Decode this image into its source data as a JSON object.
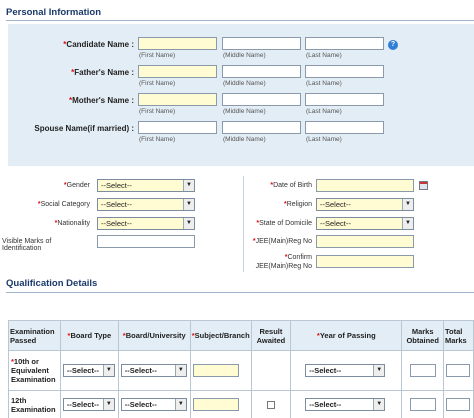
{
  "personal": {
    "title": "Personal Information",
    "rows": [
      {
        "label": "Candidate Name :",
        "required": "*"
      },
      {
        "label": "Father's Name :",
        "required": "*"
      },
      {
        "label": "Mother's Name :",
        "required": "*"
      },
      {
        "label": "Spouse Name(if married) :",
        "required": ""
      }
    ],
    "hints": {
      "first": "(First Name)",
      "middle": "(Middle Name)",
      "last": "(Last Name)"
    },
    "help_glyph": "?"
  },
  "details": {
    "left": [
      {
        "label": "Gender",
        "required": "*",
        "value": "--Select--"
      },
      {
        "label": "Social Category",
        "required": "*",
        "value": "--Select--"
      },
      {
        "label": "Nationality",
        "required": "*",
        "value": "--Select--"
      },
      {
        "label": "Visible Marks of Identification",
        "required": "",
        "value": ""
      }
    ],
    "right": [
      {
        "label": "Date of Birth",
        "required": "*",
        "value": ""
      },
      {
        "label": "Religion",
        "required": "*",
        "value": "--Select--"
      },
      {
        "label": "State of Domicile",
        "required": "*",
        "value": "--Select--"
      },
      {
        "label": "JEE(Main)Reg No",
        "required": "*",
        "value": ""
      },
      {
        "label_line1": "Confirm",
        "label_line2": "JEE(Main)Reg No",
        "required": "*",
        "value": ""
      }
    ]
  },
  "qualification": {
    "title": "Qualification Details",
    "headers": {
      "exam": "Examination Passed",
      "board_type": "Board Type",
      "board_univ": "Board/University",
      "subject": "Subject/Branch",
      "result": "Result Awaited",
      "year": "Year of Passing",
      "marks": "Marks Obtained",
      "total": "Total Marks"
    },
    "rows": [
      {
        "exam": "10th or Equivalent Examination",
        "required": "*",
        "board_type": "--Select--",
        "board_univ": "--Select--",
        "year": "--Select--"
      },
      {
        "exam": "12th Examination",
        "required": "",
        "board_type": "--Select--",
        "board_univ": "--Select--",
        "year": "--Select--"
      }
    ]
  }
}
